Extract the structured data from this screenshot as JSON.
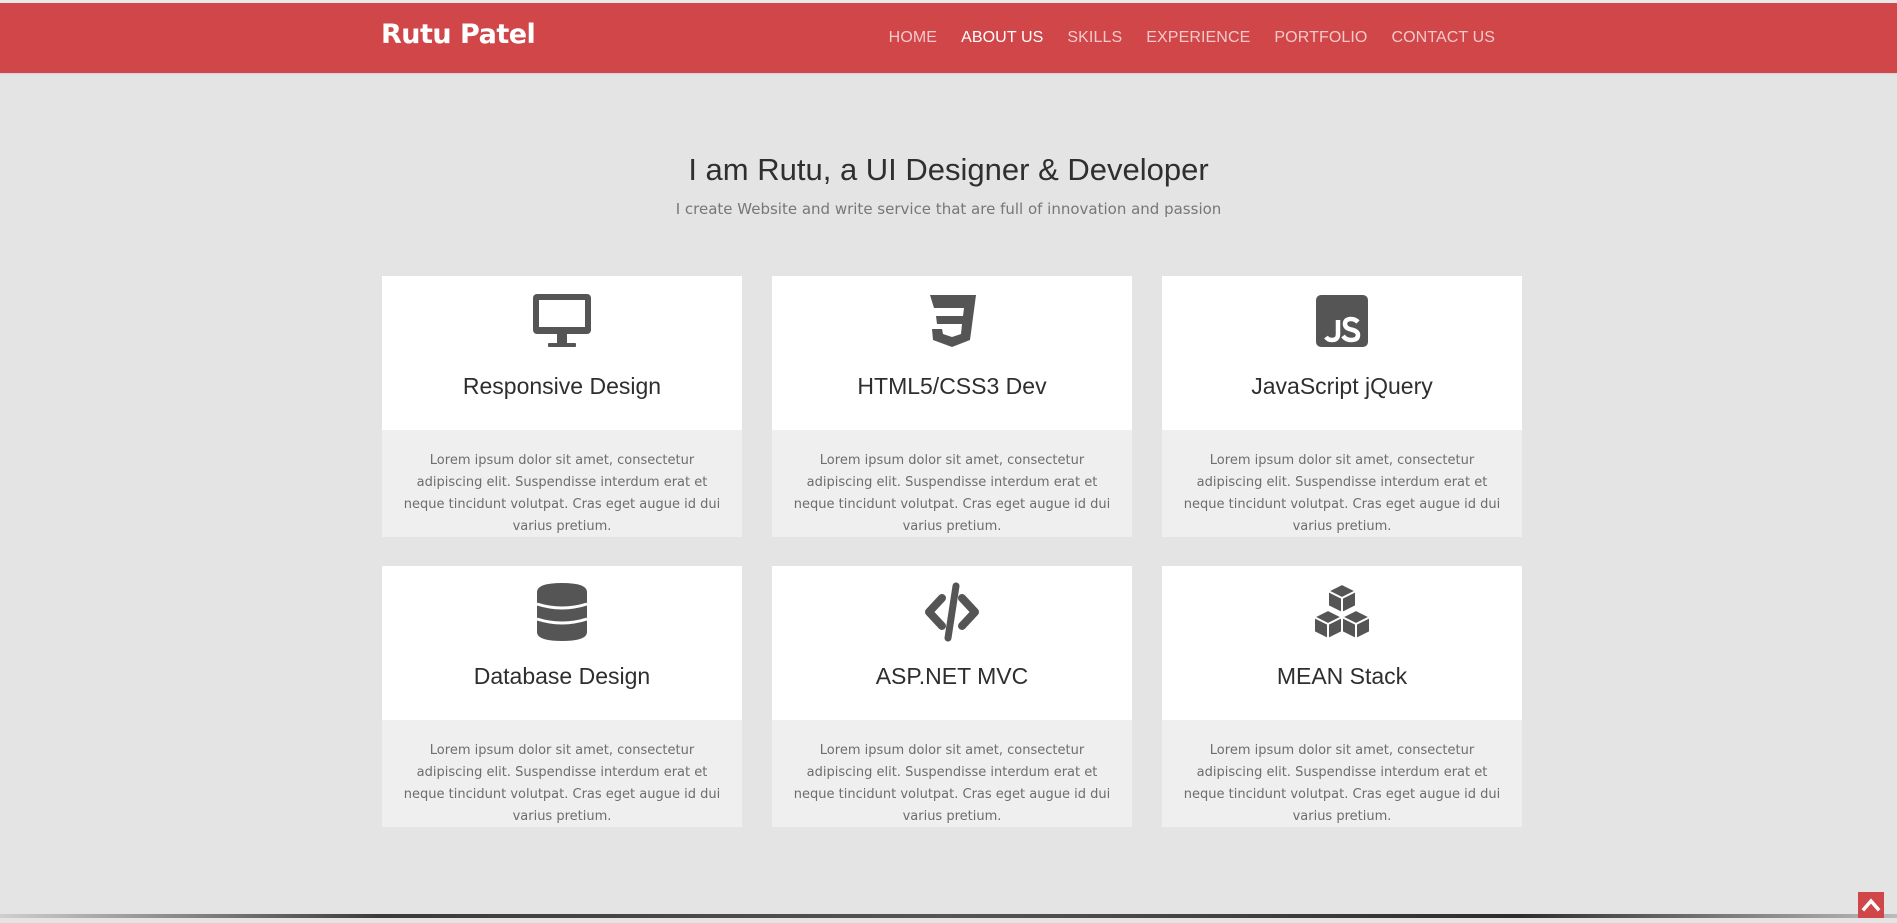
{
  "brand": {
    "name": "Rutu Patel"
  },
  "nav": {
    "items": [
      {
        "label": "HOME"
      },
      {
        "label": "ABOUT US"
      },
      {
        "label": "SKILLS"
      },
      {
        "label": "EXPERIENCE"
      },
      {
        "label": "PORTFOLIO"
      },
      {
        "label": "CONTACT US"
      }
    ],
    "active": "ABOUT US"
  },
  "hero": {
    "title": "I am Rutu, a UI Designer & Developer",
    "subtitle": "I create Website and write service that are full of innovation and passion"
  },
  "services": [
    {
      "icon": "desktop-icon",
      "title": "Responsive Design",
      "text": "Lorem ipsum dolor sit amet, consectetur adipiscing elit. Suspendisse interdum erat et neque tincidunt volutpat. Cras eget augue id dui varius pretium."
    },
    {
      "icon": "css3-icon",
      "title": "HTML5/CSS3 Dev",
      "text": "Lorem ipsum dolor sit amet, consectetur adipiscing elit. Suspendisse interdum erat et neque tincidunt volutpat. Cras eget augue id dui varius pretium."
    },
    {
      "icon": "javascript-icon",
      "title": "JavaScript jQuery",
      "text": "Lorem ipsum dolor sit amet, consectetur adipiscing elit. Suspendisse interdum erat et neque tincidunt volutpat. Cras eget augue id dui varius pretium."
    },
    {
      "icon": "database-icon",
      "title": "Database Design",
      "text": "Lorem ipsum dolor sit amet, consectetur adipiscing elit. Suspendisse interdum erat et neque tincidunt volutpat. Cras eget augue id dui varius pretium."
    },
    {
      "icon": "code-icon",
      "title": "ASP.NET MVC",
      "text": "Lorem ipsum dolor sit amet, consectetur adipiscing elit. Suspendisse interdum erat et neque tincidunt volutpat. Cras eget augue id dui varius pretium."
    },
    {
      "icon": "cubes-icon",
      "title": "MEAN Stack",
      "text": "Lorem ipsum dolor sit amet, consectetur adipiscing elit. Suspendisse interdum erat et neque tincidunt volutpat. Cras eget augue id dui varius pretium."
    }
  ],
  "scroll_top": {
    "icon": "chevron-up-icon"
  },
  "colors": {
    "accent": "#d04649",
    "background": "#e4e4e4",
    "card": "#ffffff",
    "card_footer": "#efefef",
    "icon": "#555555"
  }
}
